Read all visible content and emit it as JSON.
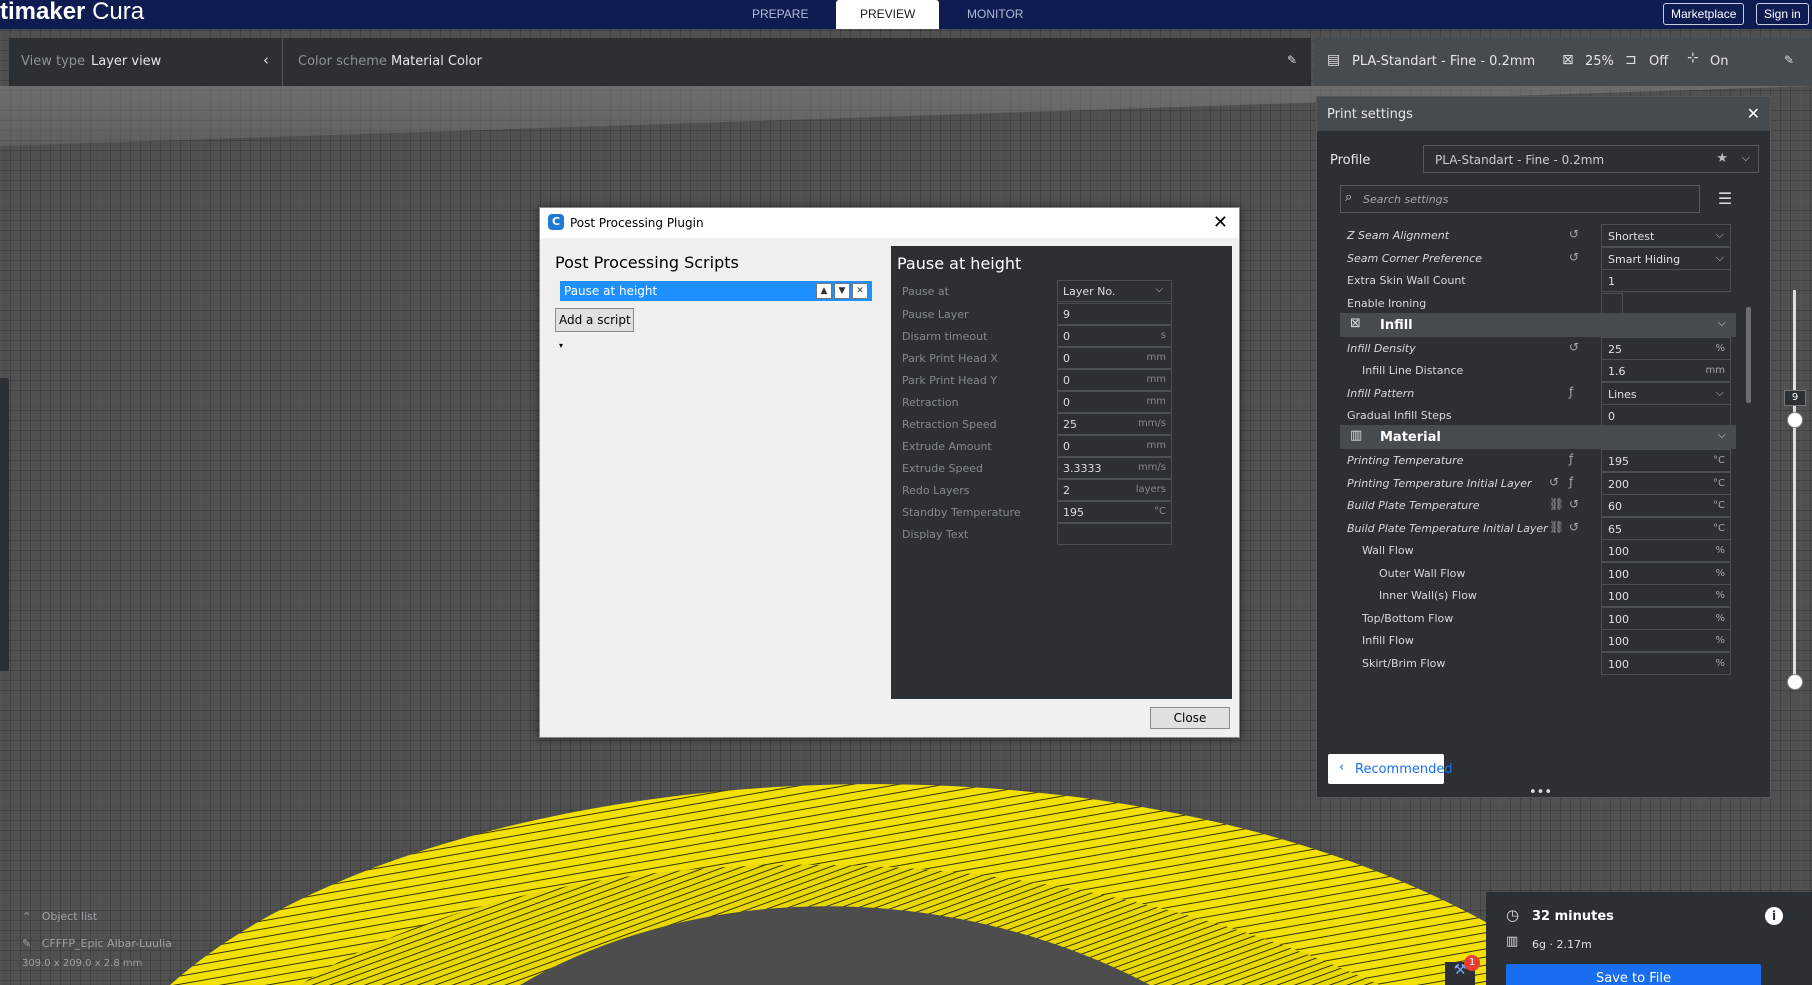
{
  "app": {
    "title_bold": "timaker",
    "title_light": "Cura",
    "stages": [
      "PREPARE",
      "PREVIEW",
      "MONITOR"
    ],
    "active_stage": "PREVIEW",
    "marketplace": "Marketplace",
    "sign_in": "Sign in"
  },
  "viewbar": {
    "view_type_label": "View type",
    "view_type_value": "Layer view",
    "color_scheme_label": "Color scheme",
    "color_scheme_value": "Material Color"
  },
  "print_bar": {
    "profile": "PLA-Standart - Fine - 0.2mm",
    "infill": "25%",
    "support": "Off",
    "adhesion": "On"
  },
  "print_settings": {
    "title": "Print settings",
    "profile_label": "Profile",
    "profile_value": "PLA-Standart - Fine - 0.2mm",
    "search_placeholder": "Search settings",
    "rows": [
      {
        "name": "Z Seam Alignment",
        "value": "Shortest",
        "unit": "",
        "italic": true,
        "icons": "reset",
        "dropdown": true,
        "indent": 0
      },
      {
        "name": "Seam Corner Preference",
        "value": "Smart Hiding",
        "unit": "",
        "italic": true,
        "icons": "reset",
        "dropdown": true,
        "indent": 0
      },
      {
        "name": "Extra Skin Wall Count",
        "value": "1",
        "unit": "",
        "italic": false,
        "icons": "",
        "dropdown": false,
        "indent": 0
      },
      {
        "name": "Enable Ironing",
        "value": "",
        "unit": "",
        "italic": false,
        "icons": "",
        "checkbox": true,
        "indent": 0
      }
    ],
    "infill_category": "Infill",
    "infill_rows": [
      {
        "name": "Infill Density",
        "value": "25",
        "unit": "%",
        "italic": true,
        "icons": "reset",
        "indent": 0
      },
      {
        "name": "Infill Line Distance",
        "value": "1.6",
        "unit": "mm",
        "italic": false,
        "icons": "",
        "indent": 1
      },
      {
        "name": "Infill Pattern",
        "value": "Lines",
        "unit": "",
        "italic": true,
        "icons": "func",
        "dropdown": true,
        "indent": 0
      },
      {
        "name": "Gradual Infill Steps",
        "value": "0",
        "unit": "",
        "italic": false,
        "icons": "",
        "indent": 0
      }
    ],
    "material_category": "Material",
    "material_rows": [
      {
        "name": "Printing Temperature",
        "value": "195",
        "unit": "°C",
        "italic": true,
        "icons": "func",
        "indent": 0
      },
      {
        "name": "Printing Temperature Initial Layer",
        "value": "200",
        "unit": "°C",
        "italic": true,
        "icons": "reset-func",
        "indent": 0
      },
      {
        "name": "Build Plate Temperature",
        "value": "60",
        "unit": "°C",
        "italic": true,
        "icons": "link-reset",
        "indent": 0
      },
      {
        "name": "Build Plate Temperature Initial Layer",
        "value": "65",
        "unit": "°C",
        "italic": true,
        "icons": "link-reset",
        "indent": 0
      },
      {
        "name": "Wall Flow",
        "value": "100",
        "unit": "%",
        "italic": false,
        "icons": "",
        "indent": 1
      },
      {
        "name": "Outer Wall Flow",
        "value": "100",
        "unit": "%",
        "italic": false,
        "icons": "",
        "indent": 2
      },
      {
        "name": "Inner Wall(s) Flow",
        "value": "100",
        "unit": "%",
        "italic": false,
        "icons": "",
        "indent": 2
      },
      {
        "name": "Top/Bottom Flow",
        "value": "100",
        "unit": "%",
        "italic": false,
        "icons": "",
        "indent": 1
      },
      {
        "name": "Infill Flow",
        "value": "100",
        "unit": "%",
        "italic": false,
        "icons": "",
        "indent": 1
      },
      {
        "name": "Skirt/Brim Flow",
        "value": "100",
        "unit": "%",
        "italic": false,
        "icons": "",
        "indent": 1
      }
    ],
    "recommended_button": "Recommended"
  },
  "layer_slider": {
    "current_layer": "9"
  },
  "object_list": {
    "title": "Object list",
    "object_name": "CFFFP_Epic Albar-Luulia",
    "dimensions": "309.0 x 209.0 x 2.8 mm"
  },
  "estimate": {
    "time": "32 minutes",
    "material": "6g · 2.17m",
    "save_button": "Save to File",
    "message_count": "1"
  },
  "dialog": {
    "title": "Post Processing Plugin",
    "heading": "Post Processing Scripts",
    "scripts": [
      "Pause at height"
    ],
    "add_script": "Add a script",
    "panel_title": "Pause at height",
    "params": [
      {
        "name": "Pause at",
        "value": "Layer No.",
        "unit": "",
        "dropdown": true
      },
      {
        "name": "Pause Layer",
        "value": "9",
        "unit": ""
      },
      {
        "name": "Disarm timeout",
        "value": "0",
        "unit": "s"
      },
      {
        "name": "Park Print Head X",
        "value": "0",
        "unit": "mm"
      },
      {
        "name": "Park Print Head Y",
        "value": "0",
        "unit": "mm"
      },
      {
        "name": "Retraction",
        "value": "0",
        "unit": "mm"
      },
      {
        "name": "Retraction Speed",
        "value": "25",
        "unit": "mm/s"
      },
      {
        "name": "Extrude Amount",
        "value": "0",
        "unit": "mm"
      },
      {
        "name": "Extrude Speed",
        "value": "3.3333",
        "unit": "mm/s"
      },
      {
        "name": "Redo Layers",
        "value": "2",
        "unit": "layers"
      },
      {
        "name": "Standby Temperature",
        "value": "195",
        "unit": "°C"
      },
      {
        "name": "Display Text",
        "value": "",
        "unit": ""
      }
    ],
    "close_button": "Close"
  },
  "colors": {
    "header": "#0e1c52",
    "panel": "#2c3033",
    "accent": "#196ef0",
    "model_yellow": "#f5e400",
    "selection": "#1e90ff"
  }
}
